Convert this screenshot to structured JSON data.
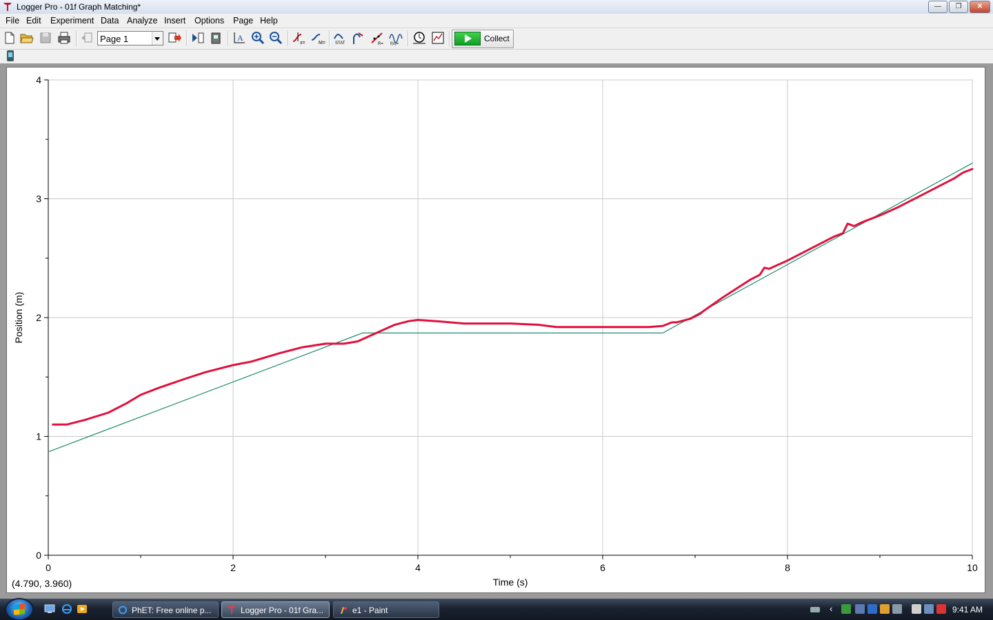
{
  "window": {
    "title": "Logger Pro - 01f Graph Matching*"
  },
  "menu": [
    "File",
    "Edit",
    "Experiment",
    "Data",
    "Analyze",
    "Insert",
    "Options",
    "Page",
    "Help"
  ],
  "toolbar": {
    "page_value": "Page 1",
    "collect_label": "Collect"
  },
  "graph": {
    "readout": "(4.790, 3.960)"
  },
  "chart_data": {
    "type": "line",
    "title": "",
    "xlabel": "Time (s)",
    "ylabel": "Position (m)",
    "xlim": [
      0,
      10
    ],
    "ylim": [
      0,
      4
    ],
    "x_ticks": [
      "0",
      "2",
      "4",
      "6",
      "8",
      "10"
    ],
    "y_ticks": [
      "0",
      "1",
      "2",
      "3",
      "4"
    ],
    "grid": true,
    "series": [
      {
        "role": "target",
        "color": "#1a8a6a",
        "x": [
          0,
          3.4,
          6.65,
          10
        ],
        "y": [
          0.87,
          1.87,
          1.87,
          3.3
        ]
      },
      {
        "role": "measured",
        "color": "#e0103c",
        "x": [
          0.05,
          0.2,
          0.4,
          0.65,
          0.85,
          1.0,
          1.2,
          1.5,
          1.7,
          2.0,
          2.2,
          2.5,
          2.75,
          3.0,
          3.2,
          3.35,
          3.55,
          3.75,
          3.9,
          4.0,
          4.2,
          4.5,
          5.0,
          5.3,
          5.5,
          6.0,
          6.5,
          6.65,
          6.75,
          6.8,
          6.95,
          7.05,
          7.1,
          7.3,
          7.6,
          7.7,
          7.75,
          7.8,
          8.0,
          8.5,
          8.6,
          8.65,
          8.72,
          8.8,
          8.9,
          9.0,
          9.2,
          9.5,
          9.8,
          9.9,
          10.0
        ],
        "y": [
          1.1,
          1.1,
          1.14,
          1.2,
          1.28,
          1.35,
          1.41,
          1.49,
          1.54,
          1.6,
          1.63,
          1.7,
          1.75,
          1.78,
          1.78,
          1.8,
          1.87,
          1.94,
          1.97,
          1.98,
          1.97,
          1.95,
          1.95,
          1.94,
          1.92,
          1.92,
          1.92,
          1.93,
          1.96,
          1.96,
          1.99,
          2.03,
          2.06,
          2.17,
          2.32,
          2.36,
          2.42,
          2.41,
          2.48,
          2.68,
          2.71,
          2.79,
          2.77,
          2.8,
          2.83,
          2.86,
          2.93,
          3.05,
          3.17,
          3.22,
          3.25
        ]
      }
    ]
  },
  "taskbar": {
    "tasks": [
      {
        "label": "PhET: Free online p..."
      },
      {
        "label": "Logger Pro - 01f Gra..."
      },
      {
        "label": "e1 - Paint"
      }
    ],
    "clock": "9:41 AM"
  }
}
